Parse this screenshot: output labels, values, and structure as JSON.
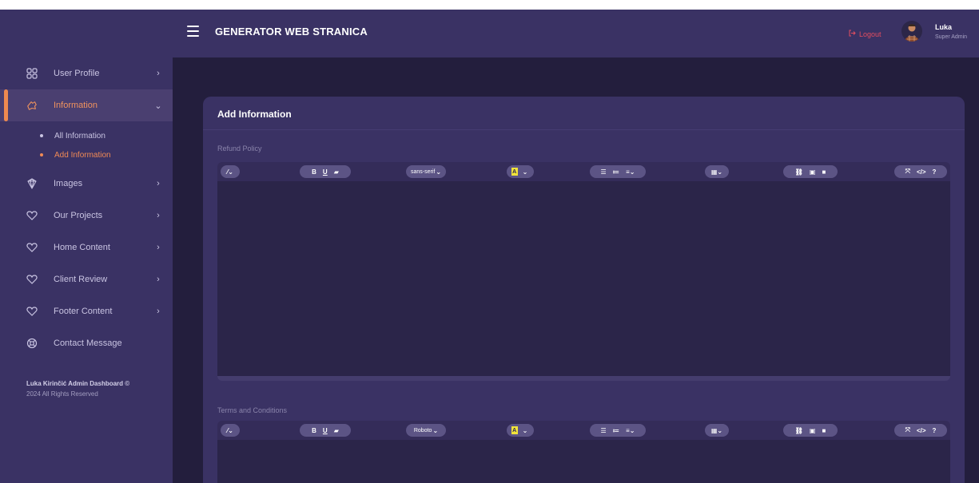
{
  "header": {
    "title": "GENERATOR WEB STRANICA",
    "logout_label": "Logout",
    "user_name": "Luka",
    "user_role": "Super Admin"
  },
  "sidebar": {
    "items": [
      {
        "label": "User Profile",
        "icon": "grid-icon"
      },
      {
        "label": "Information",
        "icon": "info-icon",
        "active": true
      },
      {
        "label": "Images",
        "icon": "image-icon"
      },
      {
        "label": "Our Projects",
        "icon": "heart-icon"
      },
      {
        "label": "Home Content",
        "icon": "heart-icon"
      },
      {
        "label": "Client Review",
        "icon": "heart-icon"
      },
      {
        "label": "Footer Content",
        "icon": "heart-icon"
      },
      {
        "label": "Contact Message",
        "icon": "support-icon"
      }
    ],
    "subitems": [
      {
        "label": "All Information"
      },
      {
        "label": "Add Information",
        "active": true
      }
    ],
    "footer_brand": "Luka Kirinčić Admin Dashboard ©",
    "footer_copy": "2024 All Rights Reserved"
  },
  "main": {
    "card_title": "Add Information",
    "fields": [
      {
        "label": "Refund Policy",
        "font": "sans-serif"
      },
      {
        "label": "Terms and Conditions",
        "font": "Roboto"
      }
    ]
  },
  "toolbar": {
    "bold": "B",
    "underline": "U",
    "highlight": "A",
    "help": "?"
  },
  "colors": {
    "accent": "#ef8a4f",
    "sidebar_bg": "#3a3264",
    "body_bg": "#231e3d",
    "logout": "#e24d5f"
  }
}
